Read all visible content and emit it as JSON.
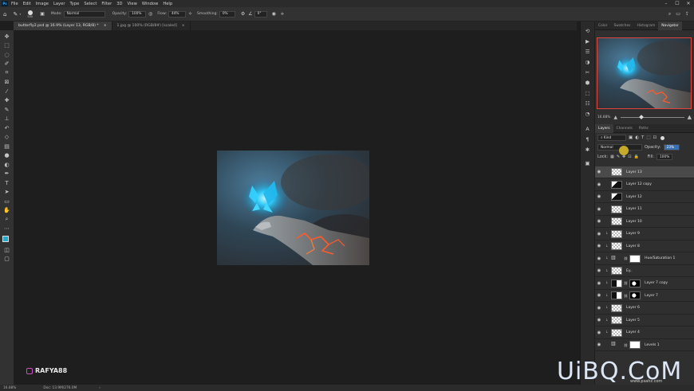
{
  "menubar": {
    "app_icon": "Ps",
    "items": [
      "File",
      "Edit",
      "Image",
      "Layer",
      "Type",
      "Select",
      "Filter",
      "3D",
      "View",
      "Window",
      "Help"
    ]
  },
  "options": {
    "brush_size": "500",
    "mode_label": "Mode:",
    "mode_value": "Normal",
    "opacity_label": "Opacity:",
    "opacity_value": "100%",
    "flow_label": "Flow:",
    "flow_value": "44%",
    "smoothing_label": "Smoothing:",
    "smoothing_value": "0%",
    "angle_value": "0°"
  },
  "tabs": [
    {
      "label": "butterfly2.psd @ 16.9% (Layer 13, RGB/8) *",
      "active": true
    },
    {
      "label": "1.jpg @ 100% (RGB/8#) [scaled]",
      "active": false
    }
  ],
  "panels": {
    "top_tabs": [
      "Color",
      "Swatches",
      "Histogram",
      "Navigator"
    ],
    "nav_zoom": "16.88%",
    "layer_tabs": [
      "Layers",
      "Channels",
      "Paths"
    ],
    "kind_label": "Kind",
    "blend_mode": "Normal",
    "opacity_label": "Opacity:",
    "opacity_value": "23%",
    "lock_label": "Lock:",
    "fill_label": "Fill:",
    "fill_value": "100%",
    "layers": [
      {
        "name": "Layer 13",
        "selected": true,
        "thumb": "check"
      },
      {
        "name": "Layer 12 copy",
        "selected": false,
        "thumb": "dark"
      },
      {
        "name": "Layer 12",
        "selected": false,
        "thumb": "dark"
      },
      {
        "name": "Layer 11",
        "selected": false,
        "thumb": "check"
      },
      {
        "name": "Layer 10",
        "selected": false,
        "thumb": "check"
      },
      {
        "name": "Layer 9",
        "selected": false,
        "thumb": "check"
      },
      {
        "name": "Layer 8",
        "selected": false,
        "thumb": "check"
      },
      {
        "name": "Hue/Saturation 1",
        "selected": false,
        "thumb": "adjust"
      },
      {
        "name": "Ey..",
        "selected": false,
        "thumb": "check"
      },
      {
        "name": "Layer 7 copy",
        "selected": false,
        "thumb": "mask"
      },
      {
        "name": "Layer 7",
        "selected": false,
        "thumb": "mask"
      },
      {
        "name": "Layer 6",
        "selected": false,
        "thumb": "check"
      },
      {
        "name": "Layer 5",
        "selected": false,
        "thumb": "check"
      },
      {
        "name": "Layer 4",
        "selected": false,
        "thumb": "check"
      },
      {
        "name": "Levels 1",
        "selected": false,
        "thumb": "adjust"
      }
    ]
  },
  "status": {
    "zoom": "16.88%",
    "doc": "Doc: 13.9M/276.0M"
  },
  "watermark": {
    "left": "RAFYA88",
    "right": "UiBQ.CoM",
    "sub": "www.psahz.com"
  }
}
